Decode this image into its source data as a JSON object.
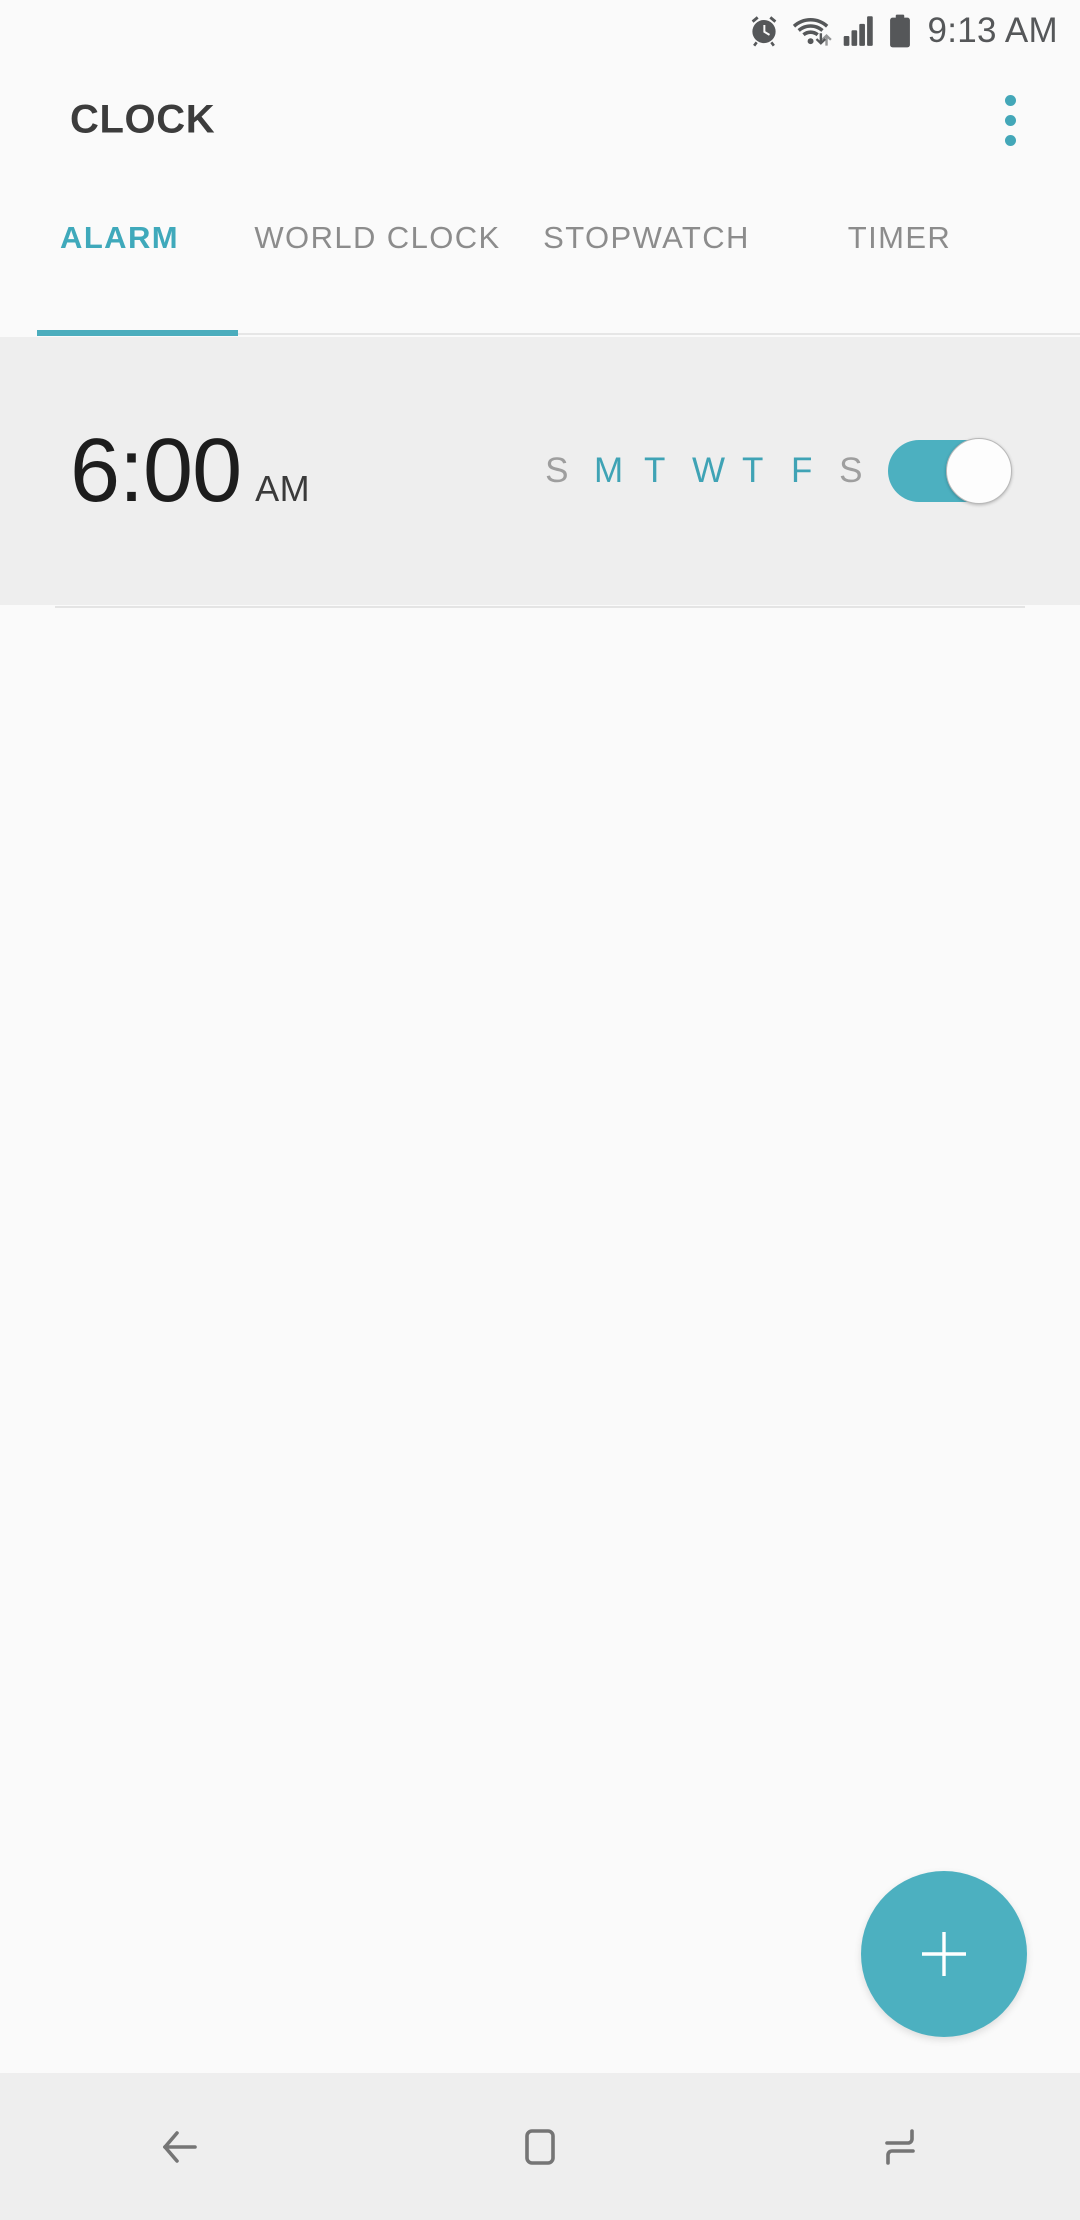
{
  "status_bar": {
    "icons": [
      "alarm-icon",
      "wifi-icon",
      "signal-icon",
      "battery-icon"
    ],
    "time": "9:13 AM"
  },
  "app_bar": {
    "title": "CLOCK",
    "overflow_label": "overflow-menu"
  },
  "tabs": [
    {
      "label": "ALARM",
      "active": true
    },
    {
      "label": "WORLD CLOCK",
      "active": false
    },
    {
      "label": "STOPWATCH",
      "active": false
    },
    {
      "label": "TIMER",
      "active": false
    }
  ],
  "alarms": [
    {
      "time": "6:00",
      "meridiem": "AM",
      "days": [
        {
          "letter": "S",
          "name": "sunday",
          "on": false
        },
        {
          "letter": "M",
          "name": "monday",
          "on": true
        },
        {
          "letter": "T",
          "name": "tuesday",
          "on": true
        },
        {
          "letter": "W",
          "name": "wednesday",
          "on": true
        },
        {
          "letter": "T",
          "name": "thursday",
          "on": true
        },
        {
          "letter": "F",
          "name": "friday",
          "on": true
        },
        {
          "letter": "S",
          "name": "saturday",
          "on": false
        }
      ],
      "enabled": true
    }
  ],
  "fab": {
    "icon": "plus-icon",
    "label": "add-alarm"
  },
  "nav_bar": {
    "buttons": [
      {
        "icon": "back-icon",
        "name": "back"
      },
      {
        "icon": "home-icon",
        "name": "home"
      },
      {
        "icon": "recents-icon",
        "name": "recents"
      }
    ]
  },
  "colors": {
    "accent": "#4cb0c0",
    "tab_active": "#3fa9bb",
    "tab_inactive": "#8c8c8c",
    "row_background": "#eeeeee",
    "page_background": "#fafafa",
    "day_off": "#9e9e9e",
    "day_on": "#3fa3b5",
    "nav_icon": "#757575",
    "status_icon": "#555759"
  }
}
